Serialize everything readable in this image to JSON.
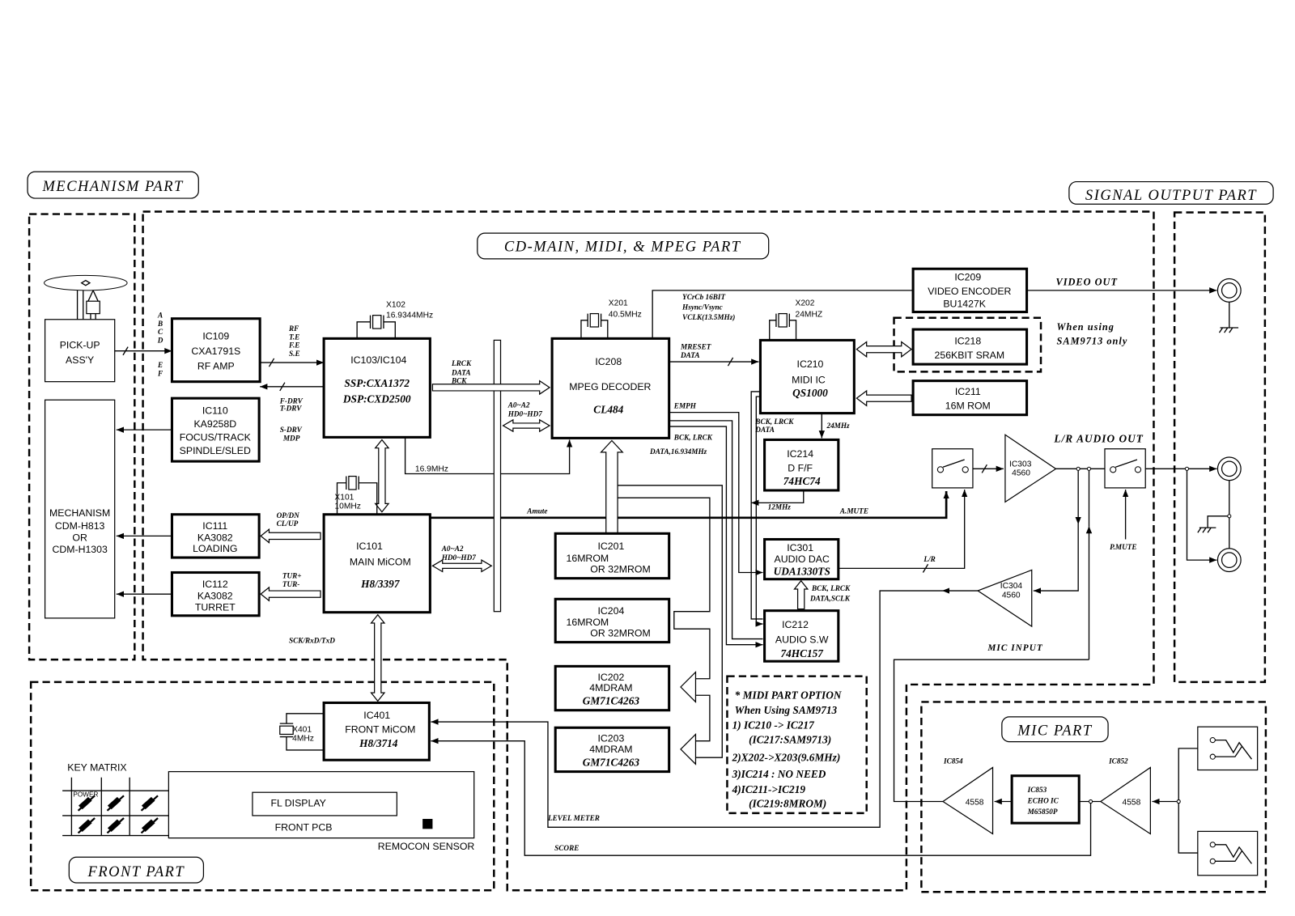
{
  "sections": {
    "mechanism": "MECHANISM PART",
    "signal_output": "SIGNAL OUTPUT PART",
    "cd_main": "CD-MAIN, MIDI, & MPEG PART",
    "front": "FRONT PART",
    "mic": "MIC PART"
  },
  "blocks": {
    "pickup": [
      "PICK-UP",
      "ASS'Y"
    ],
    "mechanism": [
      "MECHANISM",
      "CDM-H813",
      "OR",
      "CDM-H1303"
    ],
    "ic109": [
      "IC109",
      "CXA1791S",
      "RF AMP"
    ],
    "ic110": [
      "IC110",
      "KA9258D",
      "FOCUS/TRACK",
      "SPINDLE/SLED"
    ],
    "ic111": [
      "IC111",
      "KA3082",
      "LOADING"
    ],
    "ic112": [
      "IC112",
      "KA3082",
      "TURRET"
    ],
    "ic103": [
      "IC103/IC104",
      "SSP:CXA1372",
      "DSP:CXD2500"
    ],
    "ic101": [
      "IC101",
      "MAIN MiCOM",
      "H8/3397"
    ],
    "ic208": [
      "IC208",
      "MPEG DECODER",
      "CL484"
    ],
    "ic201": [
      "IC201",
      "16MROM",
      "OR 32MROM"
    ],
    "ic204": [
      "IC204",
      "16MROM",
      "OR 32MROM"
    ],
    "ic202": [
      "IC202",
      "4MDRAM",
      "GM71C4263"
    ],
    "ic203": [
      "IC203",
      "4MDRAM",
      "GM71C4263"
    ],
    "ic210": [
      "IC210",
      "MIDI IC",
      "QS1000"
    ],
    "ic214": [
      "IC214",
      "D F/F",
      "74HC74"
    ],
    "ic301": [
      "IC301",
      "AUDIO DAC",
      "UDA1330TS"
    ],
    "ic212": [
      "IC212",
      "AUDIO S.W",
      "74HC157"
    ],
    "ic209": [
      "IC209",
      "VIDEO ENCODER",
      "BU1427K"
    ],
    "ic218": [
      "IC218",
      "256KBIT SRAM"
    ],
    "ic211": [
      "IC211",
      "16M ROM"
    ],
    "ic401": [
      "IC401",
      "FRONT MiCOM",
      "H8/3714"
    ],
    "ic303": [
      "IC303",
      "4560"
    ],
    "ic304": [
      "IC304",
      "4560"
    ],
    "ic853": [
      "IC853",
      "ECHO IC",
      "M65850P"
    ],
    "ic854": [
      "IC854",
      "4558"
    ],
    "ic852": [
      "IC852",
      "4558"
    ]
  },
  "crystals": {
    "x102": [
      "X102",
      "16.9344MHz"
    ],
    "x201": [
      "X201",
      "40.5MHz"
    ],
    "x202": [
      "X202",
      "24MHZ"
    ],
    "x101": [
      "X101",
      "10MHz"
    ],
    "x401": [
      "X401",
      "4MHz"
    ]
  },
  "signals": {
    "abcd": [
      "A",
      "B",
      "C",
      "D"
    ],
    "ef": [
      "E",
      "F"
    ],
    "rf": [
      "RF",
      "T.E",
      "F.E",
      "S.E"
    ],
    "fdrv": [
      "F-DRV",
      "T-DRV"
    ],
    "sdrv": [
      "S-DRV",
      "MDP"
    ],
    "lrck": [
      "LRCK",
      "DATA",
      "BCK"
    ],
    "addr_top": [
      "A0~A2",
      "HD0~HD7"
    ],
    "addr_bottom": [
      "A0~A2",
      "HD0~HD7"
    ],
    "clk169": "16.9MHz",
    "opdn": [
      "OP/DN",
      "CL/UP"
    ],
    "tur": [
      "TUR+",
      "TUR-"
    ],
    "sck": "SCK/RxD/TxD",
    "amute_left": "Amute",
    "amute_right": "A.MUTE",
    "video_bus": [
      "YCrCb 16BIT",
      "Hsync/Vsync",
      "VCLK(13.5MHz)"
    ],
    "mreset": [
      "MRESET",
      "DATA"
    ],
    "emph": "EMPH",
    "bck208": [
      "BCK, LRCK",
      "DATA,16.934MHz"
    ],
    "bck210": [
      "BCK, LRCK",
      "DATA"
    ],
    "clk24": "24MHz",
    "clk12": "12MHz",
    "lr": "L/R",
    "bck212": [
      "BCK, LRCK",
      "DATA,SCLK"
    ],
    "video_out": "VIDEO OUT",
    "sram_note": [
      "When using",
      "SAM9713 only"
    ],
    "audio_out": "L/R AUDIO OUT",
    "pmute": "P.MUTE",
    "mic_input": "MIC INPUT",
    "level_meter": "LEVEL METER",
    "score": "SCORE"
  },
  "front": {
    "key_matrix": "KEY MATRIX",
    "power": "POWER",
    "fl_display": "FL DISPLAY",
    "front_pcb": "FRONT PCB",
    "remocon": "REMOCON SENSOR"
  },
  "note": [
    "* MIDI PART OPTION",
    "When Using SAM9713",
    "1) IC210 -> IC217",
    "(IC217:SAM9713)",
    "2)X202->X203(9.6MHz)",
    "3)IC214 : NO NEED",
    "4)IC211->IC219",
    "(IC219:8MROM)"
  ]
}
